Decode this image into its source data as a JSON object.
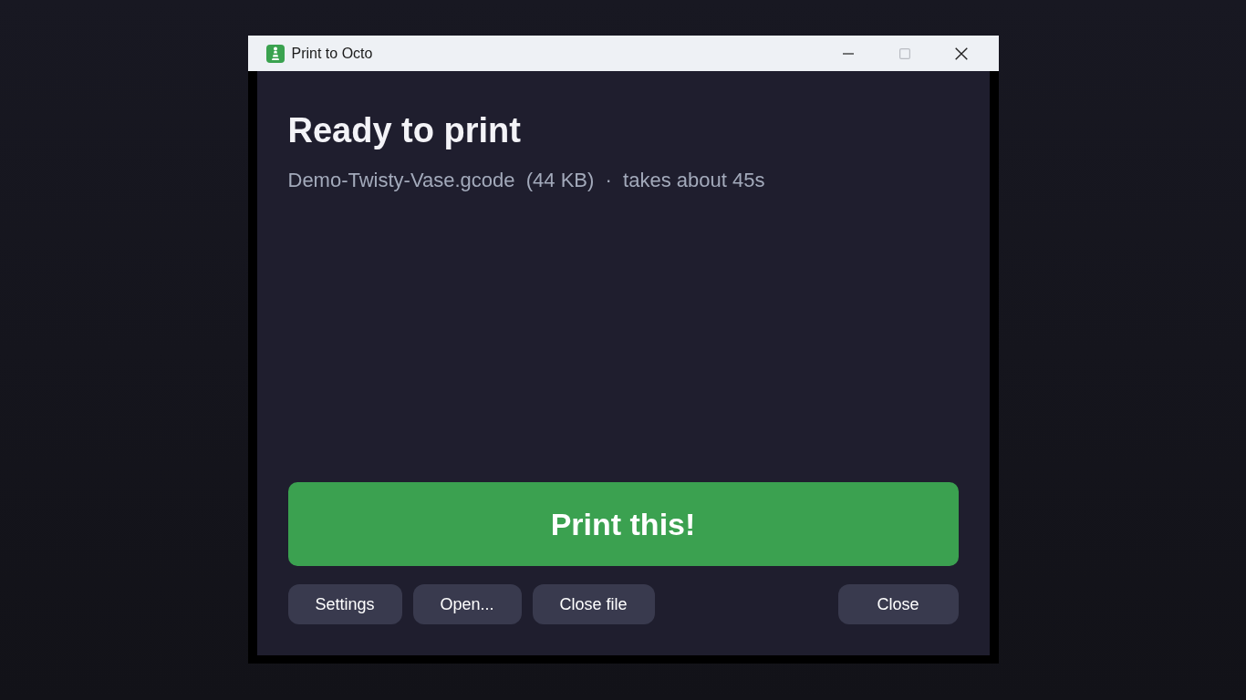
{
  "window": {
    "title": "Print to Octo"
  },
  "heading": "Ready to print",
  "file_info": "Demo-Twisty-Vase.gcode  (44 KB)  ·  takes about 45s",
  "print_button": "Print this!",
  "buttons": [
    {
      "label": "Settings"
    },
    {
      "label": "Open..."
    },
    {
      "label": "Close file"
    }
  ],
  "close_button": "Close"
}
